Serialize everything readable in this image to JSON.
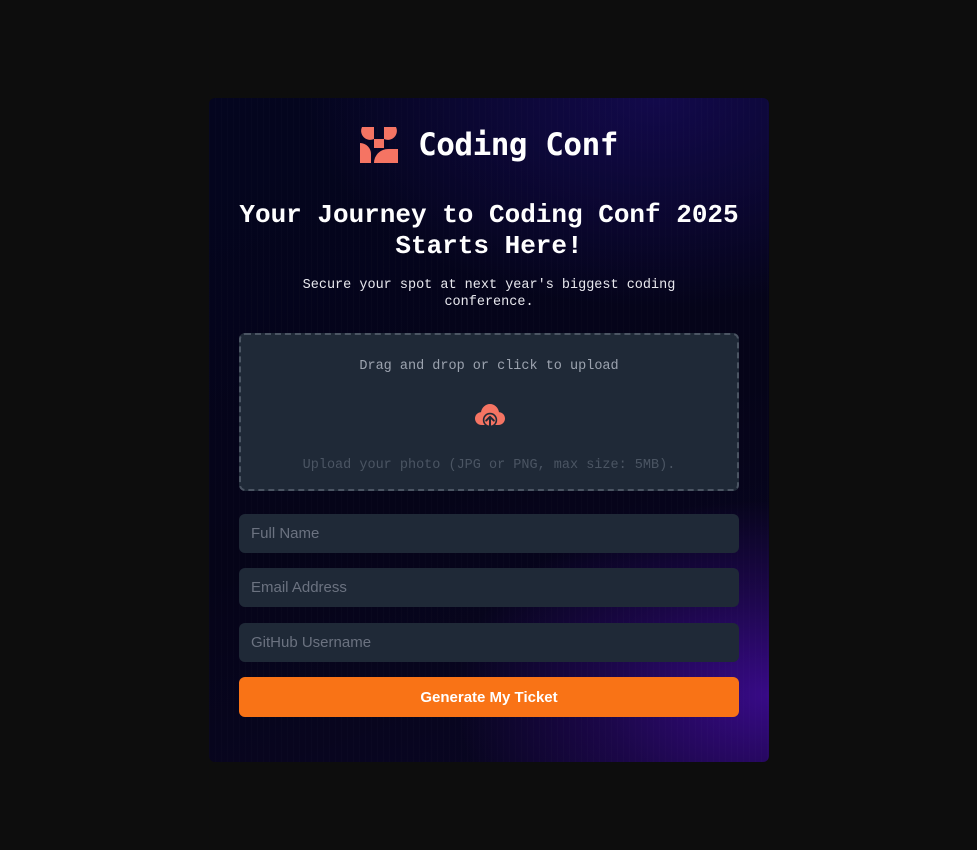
{
  "brand": {
    "name": "Coding Conf",
    "icon": "coding-conf-logo-icon",
    "accent_color": "#f57463"
  },
  "hero": {
    "headline": "Your Journey to Coding Conf 2025 Starts Here!",
    "subtitle": "Secure your spot at next year's biggest coding conference."
  },
  "upload": {
    "title": "Drag and drop or click to upload",
    "icon": "cloud-upload-icon",
    "hint": "Upload your photo (JPG or PNG, max size: 5MB)."
  },
  "form": {
    "full_name": {
      "placeholder": "Full Name",
      "value": ""
    },
    "email": {
      "placeholder": "Email Address",
      "value": ""
    },
    "github": {
      "placeholder": "GitHub Username",
      "value": ""
    },
    "submit_label": "Generate My Ticket",
    "submit_color": "#f97316"
  }
}
